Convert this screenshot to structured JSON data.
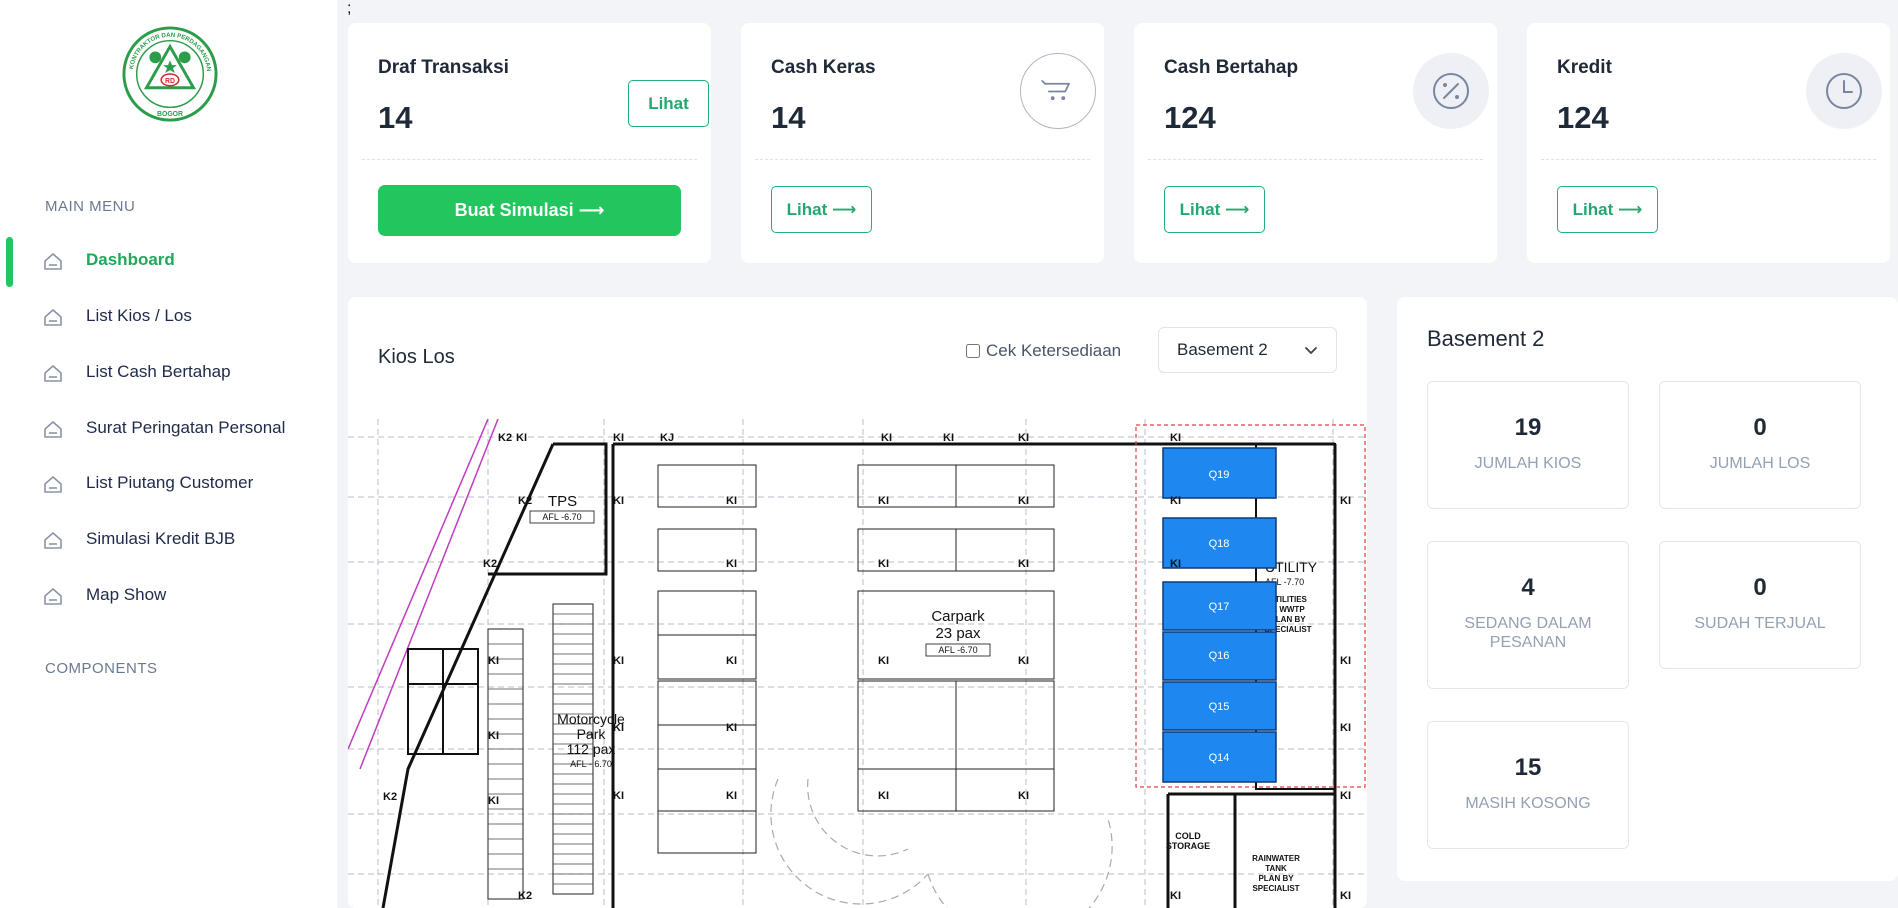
{
  "stray_text": ";",
  "sidebar": {
    "logo_text": [
      "KONTRAKTOR DAN PERDAGANGAN UMUM",
      "BOGOR",
      "RD"
    ],
    "main_menu_title": "MAIN MENU",
    "components_title": "COMPONENTS",
    "items": [
      {
        "label": "Dashboard",
        "icon": "home-icon",
        "active": true
      },
      {
        "label": "List Kios / Los",
        "icon": "home-icon"
      },
      {
        "label": "List Cash Bertahap",
        "icon": "home-icon"
      },
      {
        "label": "Surat Peringatan Personal",
        "icon": "home-icon"
      },
      {
        "label": "List Piutang Customer",
        "icon": "home-icon"
      },
      {
        "label": "Simulasi Kredit BJB",
        "icon": "home-icon"
      },
      {
        "label": "Map Show",
        "icon": "home-icon"
      }
    ]
  },
  "stats": {
    "draf": {
      "title": "Draf Transaksi",
      "value": "14",
      "view_label": "Lihat",
      "action_label": "Buat Simulasi ⟶"
    },
    "cash_keras": {
      "title": "Cash Keras",
      "value": "14",
      "view_label": "Lihat ⟶",
      "icon": "cart-icon"
    },
    "cash_bertahap": {
      "title": "Cash Bertahap",
      "value": "124",
      "view_label": "Lihat ⟶",
      "icon": "percent-icon"
    },
    "kredit": {
      "title": "Kredit",
      "value": "124",
      "view_label": "Lihat ⟶",
      "icon": "clock-icon"
    }
  },
  "map": {
    "title": "Kios Los",
    "availability_label": "Cek Ketersediaan",
    "floor_selected": "Basement 2",
    "labels": {
      "tps": "TPS",
      "tps_afl": "AFL -6.70",
      "carpark": "Carpark",
      "carpark_pax": "23 pax",
      "carpark_afl": "AFL -6.70",
      "motor": "Motorcycle",
      "motor_park": "Park",
      "motor_pax": "112 pax",
      "motor_afl": "AFL - 6.70",
      "utility": "UTILITY",
      "utility_afl": "AFL -7.70",
      "utility_note": [
        "UTILITIES",
        "& WWTP",
        "PLAN BY",
        "SPECIALIST"
      ],
      "cold": [
        "COLD",
        "STORAGE"
      ],
      "rain": [
        "RAINWATER",
        "TANK",
        "PLAN BY",
        "SPECIALIST"
      ]
    },
    "units": [
      "Q19",
      "Q18",
      "Q17",
      "Q16",
      "Q15",
      "Q14"
    ],
    "unit_color": "#1e88f0"
  },
  "summary": {
    "title": "Basement 2",
    "boxes": [
      {
        "value": "19",
        "label": "JUMLAH KIOS"
      },
      {
        "value": "0",
        "label": "JUMLAH LOS"
      },
      {
        "value": "4",
        "label": "SEDANG DALAM PESANAN"
      },
      {
        "value": "0",
        "label": "SUDAH TERJUAL"
      },
      {
        "value": "15",
        "label": "MASIH KOSONG"
      }
    ]
  },
  "colors": {
    "accent": "#22c55e",
    "accent_text": "#22a870",
    "page_bg": "#f3f4f8"
  }
}
